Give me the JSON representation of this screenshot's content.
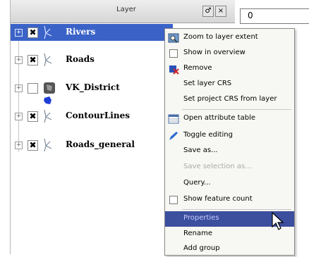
{
  "panel": {
    "title": "Layer",
    "float_button": "♂",
    "close_button": "×"
  },
  "top_input": {
    "value": "0"
  },
  "layers": [
    {
      "name": "Rivers",
      "expander": "+",
      "checked": true,
      "selected": true
    },
    {
      "name": "Roads",
      "expander": "+",
      "checked": true,
      "selected": false
    },
    {
      "name": "VK_District",
      "expander": "+",
      "checked": false,
      "selected": false
    },
    {
      "name": "ContourLines",
      "expander": "+",
      "checked": true,
      "selected": false
    },
    {
      "name": "Roads_general",
      "expander": "+",
      "checked": true,
      "selected": false
    }
  ],
  "check_mark": "✖",
  "menu": {
    "items": [
      {
        "label": "Zoom to layer extent",
        "icon": "zoom-extent-icon"
      },
      {
        "label": "Show in overview",
        "icon": "checkbox"
      },
      {
        "label": "Remove",
        "icon": "remove-icon"
      },
      {
        "label": "Set layer CRS",
        "icon": ""
      },
      {
        "label": "Set project CRS from layer",
        "icon": ""
      },
      {
        "label": "Open attribute table",
        "icon": "table-icon"
      },
      {
        "label": "Toggle editing",
        "icon": "pencil-icon"
      },
      {
        "label": "Save as...",
        "icon": ""
      },
      {
        "label": "Save selection as...",
        "icon": "",
        "disabled": true
      },
      {
        "label": "Query...",
        "icon": ""
      },
      {
        "label": "Show feature count",
        "icon": "checkbox"
      },
      {
        "label": "Properties",
        "icon": "",
        "highlight": true
      },
      {
        "label": "Rename",
        "icon": ""
      },
      {
        "label": "Add group",
        "icon": ""
      }
    ]
  },
  "colors": {
    "selection": "#3a62c7",
    "menu_highlight": "#3b4f9e",
    "district_fill": "#1f3fd6"
  }
}
